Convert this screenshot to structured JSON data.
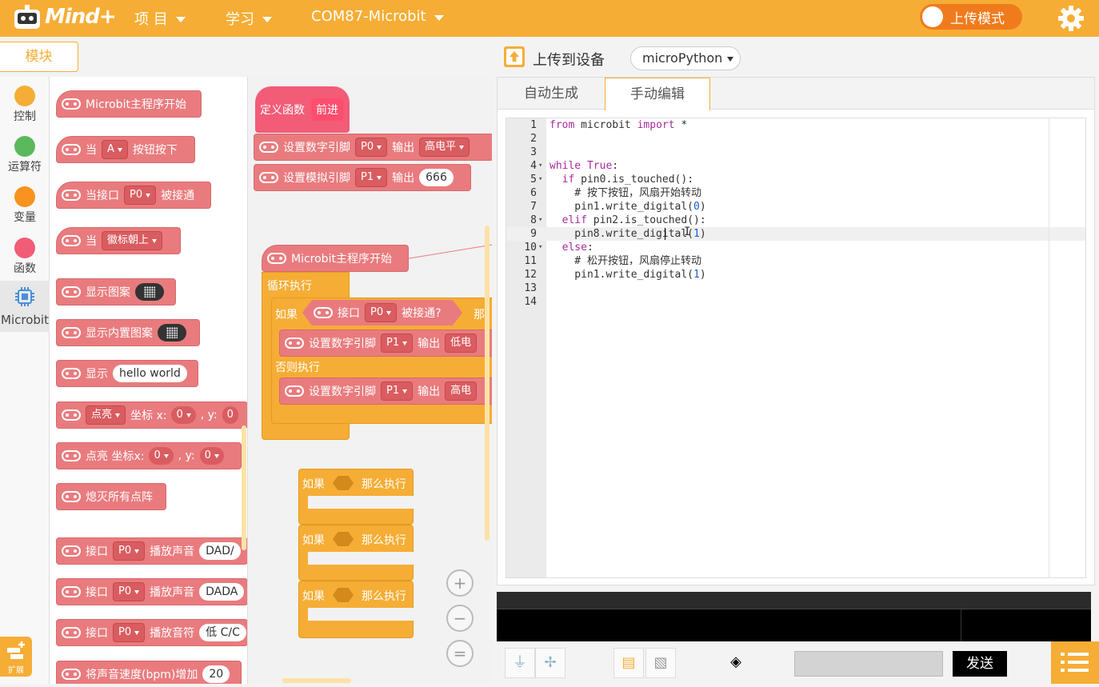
{
  "app": {
    "logo_text": "Mind+",
    "menu": [
      {
        "label": "项 目"
      },
      {
        "label": "学习"
      },
      {
        "label": "COM87-Microbit"
      }
    ],
    "mode_toggle_label": "上传模式"
  },
  "toolbar": {
    "modules_tab": "模块",
    "upload_label": "上传到设备",
    "language_selected": "microPython"
  },
  "categories": [
    {
      "label": "控制",
      "color": "#f6ad35"
    },
    {
      "label": "运算符",
      "color": "#5cb85c"
    },
    {
      "label": "变量",
      "color": "#f7931e"
    },
    {
      "label": "函数",
      "color": "#f25c77"
    },
    {
      "label": "Microbit",
      "color": "#4a90d9"
    }
  ],
  "extension_label": "扩展",
  "palette": {
    "b1": "Microbit主程序开始",
    "b2_pre": "当",
    "b2_dd": "A",
    "b2_post": "按钮按下",
    "b3_pre": "当接口",
    "b3_dd": "P0",
    "b3_post": "被接通",
    "b4_pre": "当",
    "b4_dd": "徽标朝上",
    "b5": "显示图案",
    "b6": "显示内置图案",
    "b7_pre": "显示",
    "b7_field": "hello world",
    "b8_dd": "点亮",
    "b8_mid": "坐标 x:",
    "b8_v1": "0",
    "b8_y": ", y:",
    "b8_v2": "0",
    "b9": "点亮 坐标x:",
    "b9_v1": "0",
    "b9_y": ", y:",
    "b9_v2": "0",
    "b10": "熄灭所有点阵",
    "b11_pre": "接口",
    "b11_dd": "P0",
    "b11_mid": "播放声音",
    "b11_field": "DAD/",
    "b12_pre": "接口",
    "b12_dd": "P0",
    "b12_mid": "播放声音",
    "b12_field": "DADA",
    "b13_pre": "接口",
    "b13_dd": "P0",
    "b13_mid": "播放音符",
    "b13_field": "低 C/C",
    "b14": "将声音速度(bpm)增加",
    "b14_field": "20"
  },
  "workspace": {
    "def_func": "定义函数",
    "def_name": "前进",
    "w1_pre": "设置数字引脚",
    "w1_dd": "P0",
    "w1_mid": "输出",
    "w1_dd2": "高电平",
    "w2_pre": "设置模拟引脚",
    "w2_dd": "P1",
    "w2_mid": "输出",
    "w2_field": "666",
    "main": "Microbit主程序开始",
    "loop": "循环执行",
    "if": "如果",
    "cond_pre": "接口",
    "cond_dd": "P0",
    "cond_post": "被接通?",
    "then": "那",
    "set1_pre": "设置数字引脚",
    "set1_dd": "P1",
    "set1_mid": "输出",
    "set1_dd2": "低电",
    "else": "否则执行",
    "set2_pre": "设置数字引脚",
    "set2_dd": "P1",
    "set2_mid": "输出",
    "set2_dd2": "高电",
    "ifthen_if": "如果",
    "ifthen_then": "那么执行"
  },
  "code_tabs": [
    "自动生成",
    "手动编辑"
  ],
  "code_lines": [
    {
      "n": "1",
      "fold": "",
      "html": "<span class='kw'>from</span> microbit <span class='kw'>import</span> *"
    },
    {
      "n": "2",
      "fold": "",
      "html": ""
    },
    {
      "n": "3",
      "fold": "",
      "html": ""
    },
    {
      "n": "4",
      "fold": "▾",
      "html": "<span class='kw'>while</span> <span class='kw'>True</span>:"
    },
    {
      "n": "5",
      "fold": "▾",
      "html": "  <span class='kw'>if</span> pin0.is_touched():"
    },
    {
      "n": "6",
      "fold": "",
      "html": "    # 按下按钮，风扇开始转动"
    },
    {
      "n": "7",
      "fold": "",
      "html": "    pin1.write_digital(<span class='num'>0</span>)"
    },
    {
      "n": "8",
      "fold": "▾",
      "html": "  <span class='kw'>elif</span> pin2.is_touched():"
    },
    {
      "n": "9",
      "fold": "",
      "html": "    pin8.write_digital(<span class='num'>1</span>)"
    },
    {
      "n": "10",
      "fold": "▾",
      "html": "  <span class='kw'>else</span>:"
    },
    {
      "n": "11",
      "fold": "",
      "html": "    # 松开按钮，风扇停止转动"
    },
    {
      "n": "12",
      "fold": "",
      "html": "    pin1.write_digital(<span class='num'>1</span>)"
    },
    {
      "n": "13",
      "fold": "",
      "html": ""
    },
    {
      "n": "14",
      "fold": "",
      "html": ""
    }
  ],
  "serial": {
    "send_label": "发送"
  }
}
